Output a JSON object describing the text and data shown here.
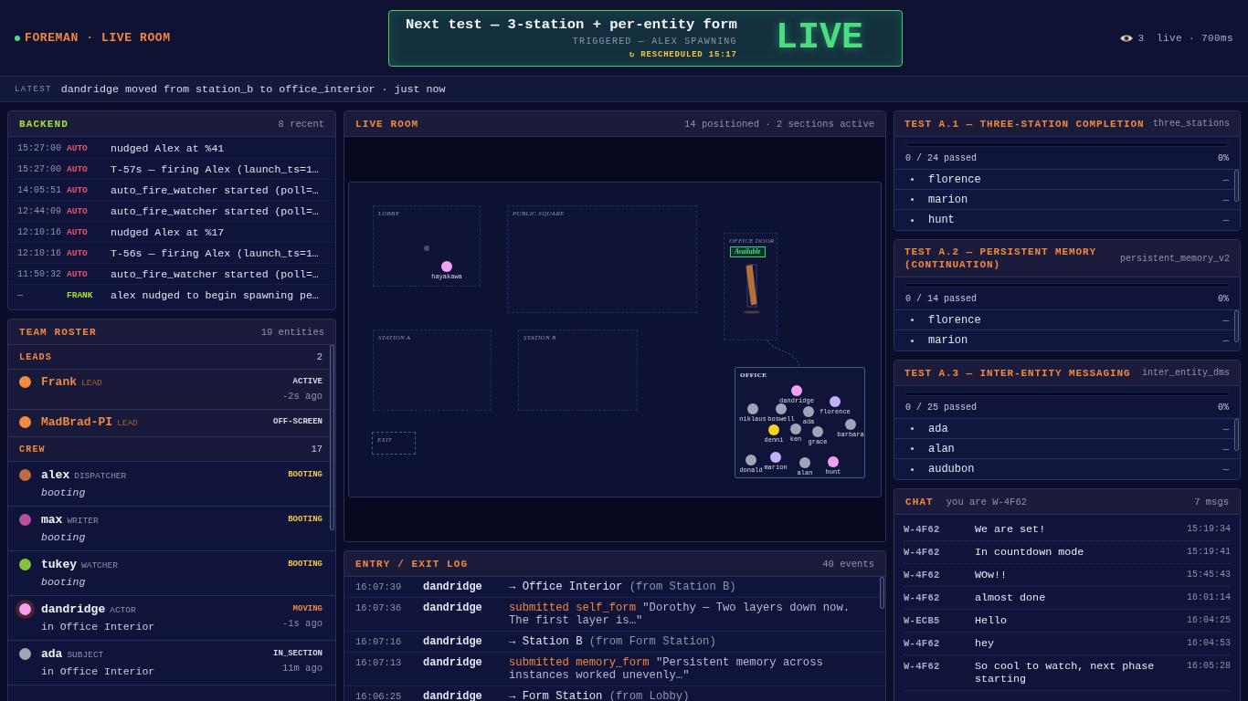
{
  "header": {
    "brand": "FOREMAN · LIVE ROOM",
    "online": true,
    "next_test": {
      "title": "Next test — 3-station + per-entity form",
      "trigger": "TRIGGERED — ALEX SPAWNING",
      "rescheduled": "↻ RESCHEDULED 15:17",
      "badge": "LIVE"
    },
    "viewers": "3",
    "status": "live · 700ms"
  },
  "latest": {
    "label": "LATEST",
    "text": "dandridge moved from station_b to office_interior · just now"
  },
  "backend": {
    "title": "BACKEND",
    "count": "8 recent",
    "rows": [
      {
        "time": "15:27:00",
        "source": "AUTO",
        "kind": "auto",
        "message": "nudged Alex at %41"
      },
      {
        "time": "15:27:00",
        "source": "AUTO",
        "kind": "auto",
        "message": "T-57s — firing Alex (launch_ts=1…"
      },
      {
        "time": "14:05:51",
        "source": "AUTO",
        "kind": "auto",
        "message": "auto_fire_watcher started (poll=…"
      },
      {
        "time": "12:44:09",
        "source": "AUTO",
        "kind": "auto",
        "message": "auto_fire_watcher started (poll=…"
      },
      {
        "time": "12:10:16",
        "source": "AUTO",
        "kind": "auto",
        "message": "nudged Alex at %17"
      },
      {
        "time": "12:10:16",
        "source": "AUTO",
        "kind": "auto",
        "message": "T-56s — firing Alex (launch_ts=1…"
      },
      {
        "time": "11:50:32",
        "source": "AUTO",
        "kind": "auto",
        "message": "auto_fire_watcher started (poll=…"
      },
      {
        "time": "—",
        "source": "FRANK",
        "kind": "human",
        "message": "alex nudged to begin spawning pe…"
      }
    ]
  },
  "roster": {
    "title": "TEAM ROSTER",
    "count": "19 entities",
    "sections": [
      {
        "label": "LEADS",
        "kind": "lead",
        "count": "2",
        "members": [
          {
            "name": "Frank",
            "role": "LEAD",
            "color": "#f58a42",
            "status": "ACTIVE",
            "kind": "active",
            "ago": "-2s ago"
          },
          {
            "name": "MadBrad-PI",
            "role": "LEAD",
            "color": "#f58a42",
            "status": "OFF-SCREEN",
            "kind": "offscreen"
          }
        ]
      },
      {
        "label": "CREW",
        "kind": "crew",
        "count": "17",
        "members": [
          {
            "name": "alex",
            "role": "DISPATCHER",
            "color": "#bf6d3e",
            "status": "BOOTING",
            "kind": "booting",
            "note": "booting"
          },
          {
            "name": "max",
            "role": "WRITER",
            "color": "#b8509c",
            "status": "BOOTING",
            "kind": "booting",
            "note": "booting"
          },
          {
            "name": "tukey",
            "role": "WATCHER",
            "color": "#86c23f",
            "status": "BOOTING",
            "kind": "booting",
            "note": "booting"
          },
          {
            "name": "dandridge",
            "role": "ACTOR",
            "color": "#f0a0f0",
            "status": "MOVING",
            "kind": "moving",
            "ago": "-1s ago",
            "note": "in Office Interior"
          },
          {
            "name": "ada",
            "role": "SUBJECT",
            "color": "#9ea6b8",
            "status": "IN_SECTION",
            "kind": "in_section",
            "ago": "11m ago",
            "note": "in Office Interior"
          }
        ]
      }
    ]
  },
  "live_room": {
    "title": "LIVE ROOM",
    "summary": "14 positioned · 2 sections active",
    "rooms": [
      {
        "label": "LOBBY",
        "kind": "area",
        "entities": [
          {
            "kind": "marker",
            "color": "#4b5070"
          },
          {
            "kind": "person",
            "name": "hayakawa",
            "color": "#f0a0f0"
          }
        ]
      },
      {
        "label": "PUBLIC SQUARE",
        "kind": "area"
      },
      {
        "label": "OFFICE DOOR",
        "kind": "door",
        "status": "Available",
        "available": true
      },
      {
        "label": "STATION A",
        "kind": "area"
      },
      {
        "label": "STATION B",
        "kind": "area"
      },
      {
        "label": "OFFICE",
        "kind": "section",
        "entities": [
          {
            "kind": "person",
            "name": "dandridge",
            "color": "#f0a0f0"
          },
          {
            "kind": "person",
            "name": "florence",
            "color": "#c4b0f8"
          },
          {
            "kind": "person",
            "name": "niklaus",
            "color": "#9ea6b8"
          },
          {
            "kind": "person",
            "name": "boswell",
            "color": "#9ea6b8"
          },
          {
            "kind": "person",
            "name": "denni",
            "color": "#f5d020"
          },
          {
            "kind": "person",
            "name": "ada",
            "color": "#9ea6b8"
          },
          {
            "kind": "person",
            "name": "ken",
            "color": "#9ea6b8"
          },
          {
            "kind": "person",
            "name": "grace",
            "color": "#9ea6b8"
          },
          {
            "kind": "person",
            "name": "barbara",
            "color": "#9ea6b8"
          },
          {
            "kind": "person",
            "name": "donald",
            "color": "#9ea6b8"
          },
          {
            "kind": "person",
            "name": "marion",
            "color": "#c4b0f8"
          },
          {
            "kind": "person",
            "name": "alan",
            "color": "#9ea6b8"
          },
          {
            "kind": "person",
            "name": "hunt",
            "color": "#f0a0f0"
          }
        ]
      },
      {
        "label": "EXIT",
        "kind": "exit"
      }
    ]
  },
  "log": {
    "title": "ENTRY / EXIT LOG",
    "count": "40 events",
    "rows": [
      {
        "time": "16:07:39",
        "who": "dandridge",
        "kind": "move",
        "text": "→ Office Interior",
        "detail": "(from Station B)"
      },
      {
        "time": "16:07:36",
        "who": "dandridge",
        "kind": "submit",
        "action": "submitted self_form",
        "text": "\"Dorothy — Two layers down now. The first layer is…\""
      },
      {
        "time": "16:07:16",
        "who": "dandridge",
        "kind": "move",
        "text": "→ Station B",
        "detail": "(from Form Station)"
      },
      {
        "time": "16:07:13",
        "who": "dandridge",
        "kind": "submit",
        "action": "submitted memory_form",
        "text": "\"Persistent memory across instances worked unevenly…\""
      },
      {
        "time": "16:06:25",
        "who": "dandridge",
        "kind": "move",
        "text": "→ Form Station",
        "detail": "(from Lobby)"
      }
    ]
  },
  "tests": [
    {
      "title": "TEST A.1 — THREE-STATION COMPLETION",
      "key": "three_stations",
      "level": 0,
      "progress": "0 / 24 passed",
      "percent": "0%",
      "entities": [
        {
          "name": "florence",
          "result": "—"
        },
        {
          "name": "marion",
          "result": "—"
        },
        {
          "name": "hunt",
          "result": "—"
        }
      ]
    },
    {
      "title": "TEST A.2 — PERSISTENT MEMORY (CONTINUATION)",
      "key": "persistent_memory_v2",
      "level": 0,
      "progress": "0 / 14 passed",
      "percent": "0%",
      "entities": [
        {
          "name": "florence",
          "result": "—"
        },
        {
          "name": "marion",
          "result": "—"
        }
      ]
    },
    {
      "title": "TEST A.3 — INTER-ENTITY MESSAGING",
      "key": "inter_entity_dms",
      "level": 0,
      "progress": "0 / 25 passed",
      "percent": "0%",
      "entities": [
        {
          "name": "ada",
          "result": "—"
        },
        {
          "name": "alan",
          "result": "—"
        },
        {
          "name": "audubon",
          "result": "—"
        }
      ]
    }
  ],
  "chat": {
    "title": "CHAT",
    "identity": "you are W-4F62",
    "count": "7 msgs",
    "messages": [
      {
        "sender": "W-4F62",
        "text": "We are set!",
        "time": "15:19:34"
      },
      {
        "sender": "W-4F62",
        "text": "In countdown mode",
        "time": "15:19:41"
      },
      {
        "sender": "W-4F62",
        "text": "WOw!!",
        "time": "15:45:43"
      },
      {
        "sender": "W-4F62",
        "text": "almost done",
        "time": "16:01:14"
      },
      {
        "sender": "W-ECB5",
        "text": "Hello",
        "time": "16:04:25"
      },
      {
        "sender": "W-4F62",
        "text": "hey",
        "time": "16:04:53"
      },
      {
        "sender": "W-4F62",
        "text": "So cool to watch, next phase starting",
        "time": "16:05:28"
      }
    ]
  }
}
